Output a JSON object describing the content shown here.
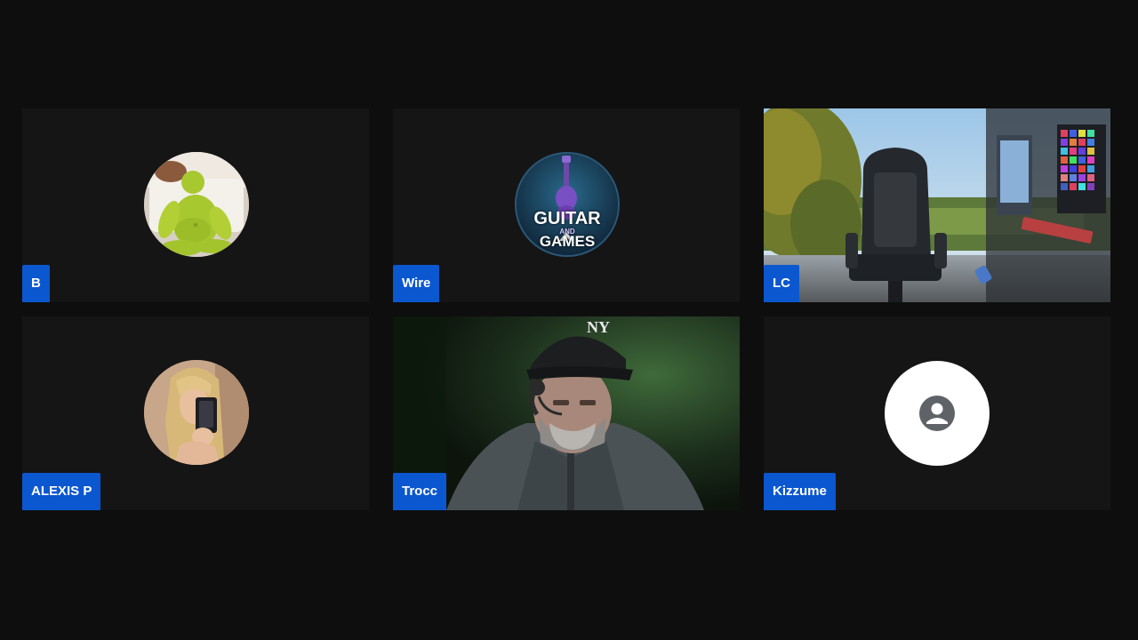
{
  "participants": [
    {
      "name": "B",
      "media": "avatar",
      "icon": "ogre-figure-avatar"
    },
    {
      "name": "Wire",
      "media": "avatar",
      "icon": "guitar-and-games-logo",
      "logo": {
        "line1": "GUITAR",
        "line2": "AND",
        "line3": "GAMES"
      }
    },
    {
      "name": "LC",
      "media": "video",
      "icon": "gaming-room-video"
    },
    {
      "name": "ALEXIS P",
      "media": "avatar",
      "icon": "selfie-photo-avatar"
    },
    {
      "name": "Trocc",
      "media": "video",
      "icon": "man-with-headset-video"
    },
    {
      "name": "Kizzume",
      "media": "avatar",
      "icon": "default-person-icon"
    }
  ],
  "colors": {
    "background": "#0e0e0e",
    "tile": "#151515",
    "name_tag": "#0b57d0",
    "name_text": "#ffffff"
  }
}
